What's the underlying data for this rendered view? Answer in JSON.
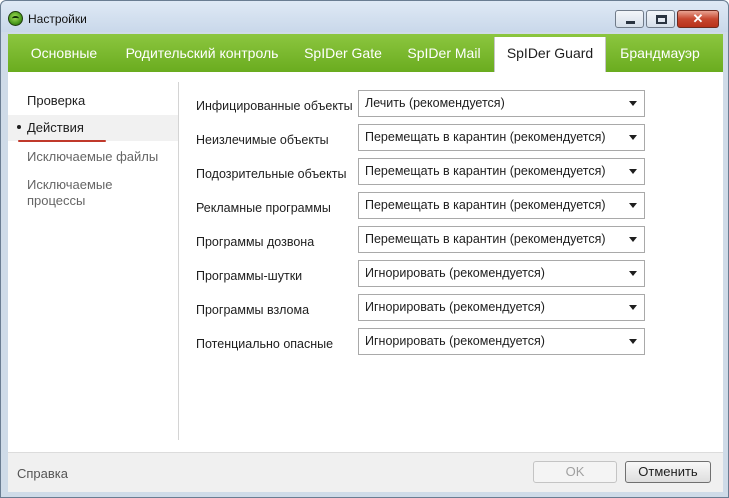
{
  "window": {
    "title": "Настройки"
  },
  "tabs": [
    {
      "label": "Основные"
    },
    {
      "label": "Родительский контроль"
    },
    {
      "label": "SpIDer Gate"
    },
    {
      "label": "SpIDer Mail"
    },
    {
      "label": "SpIDer Guard",
      "active": true
    },
    {
      "label": "Брандмауэр"
    }
  ],
  "sidebar": {
    "items": [
      {
        "label": "Проверка"
      },
      {
        "label": "Действия",
        "active": true
      },
      {
        "label": "Исключаемые файлы"
      },
      {
        "label": "Исключаемые\nпроцессы"
      }
    ]
  },
  "actions": {
    "rows": [
      {
        "label": "Инфицированные объекты",
        "value": "Лечить (рекомендуется)"
      },
      {
        "label": "Неизлечимые объекты",
        "value": "Перемещать в карантин (рекомендуется)"
      },
      {
        "label": "Подозрительные объекты",
        "value": "Перемещать в карантин (рекомендуется)"
      },
      {
        "label": "Рекламные программы",
        "value": "Перемещать в карантин (рекомендуется)"
      },
      {
        "label": "Программы дозвона",
        "value": "Перемещать в карантин (рекомендуется)"
      },
      {
        "label": "Программы-шутки",
        "value": "Игнорировать (рекомендуется)"
      },
      {
        "label": "Программы взлома",
        "value": "Игнорировать (рекомендуется)"
      },
      {
        "label": "Потенциально опасные",
        "value": "Игнорировать (рекомендуется)"
      }
    ]
  },
  "footer": {
    "help": "Справка",
    "ok": "OK",
    "cancel": "Отменить"
  },
  "colors": {
    "accent_green": "#7dba2f",
    "active_tab_bg": "#ffffff",
    "highlight_underline": "#c0392b"
  }
}
